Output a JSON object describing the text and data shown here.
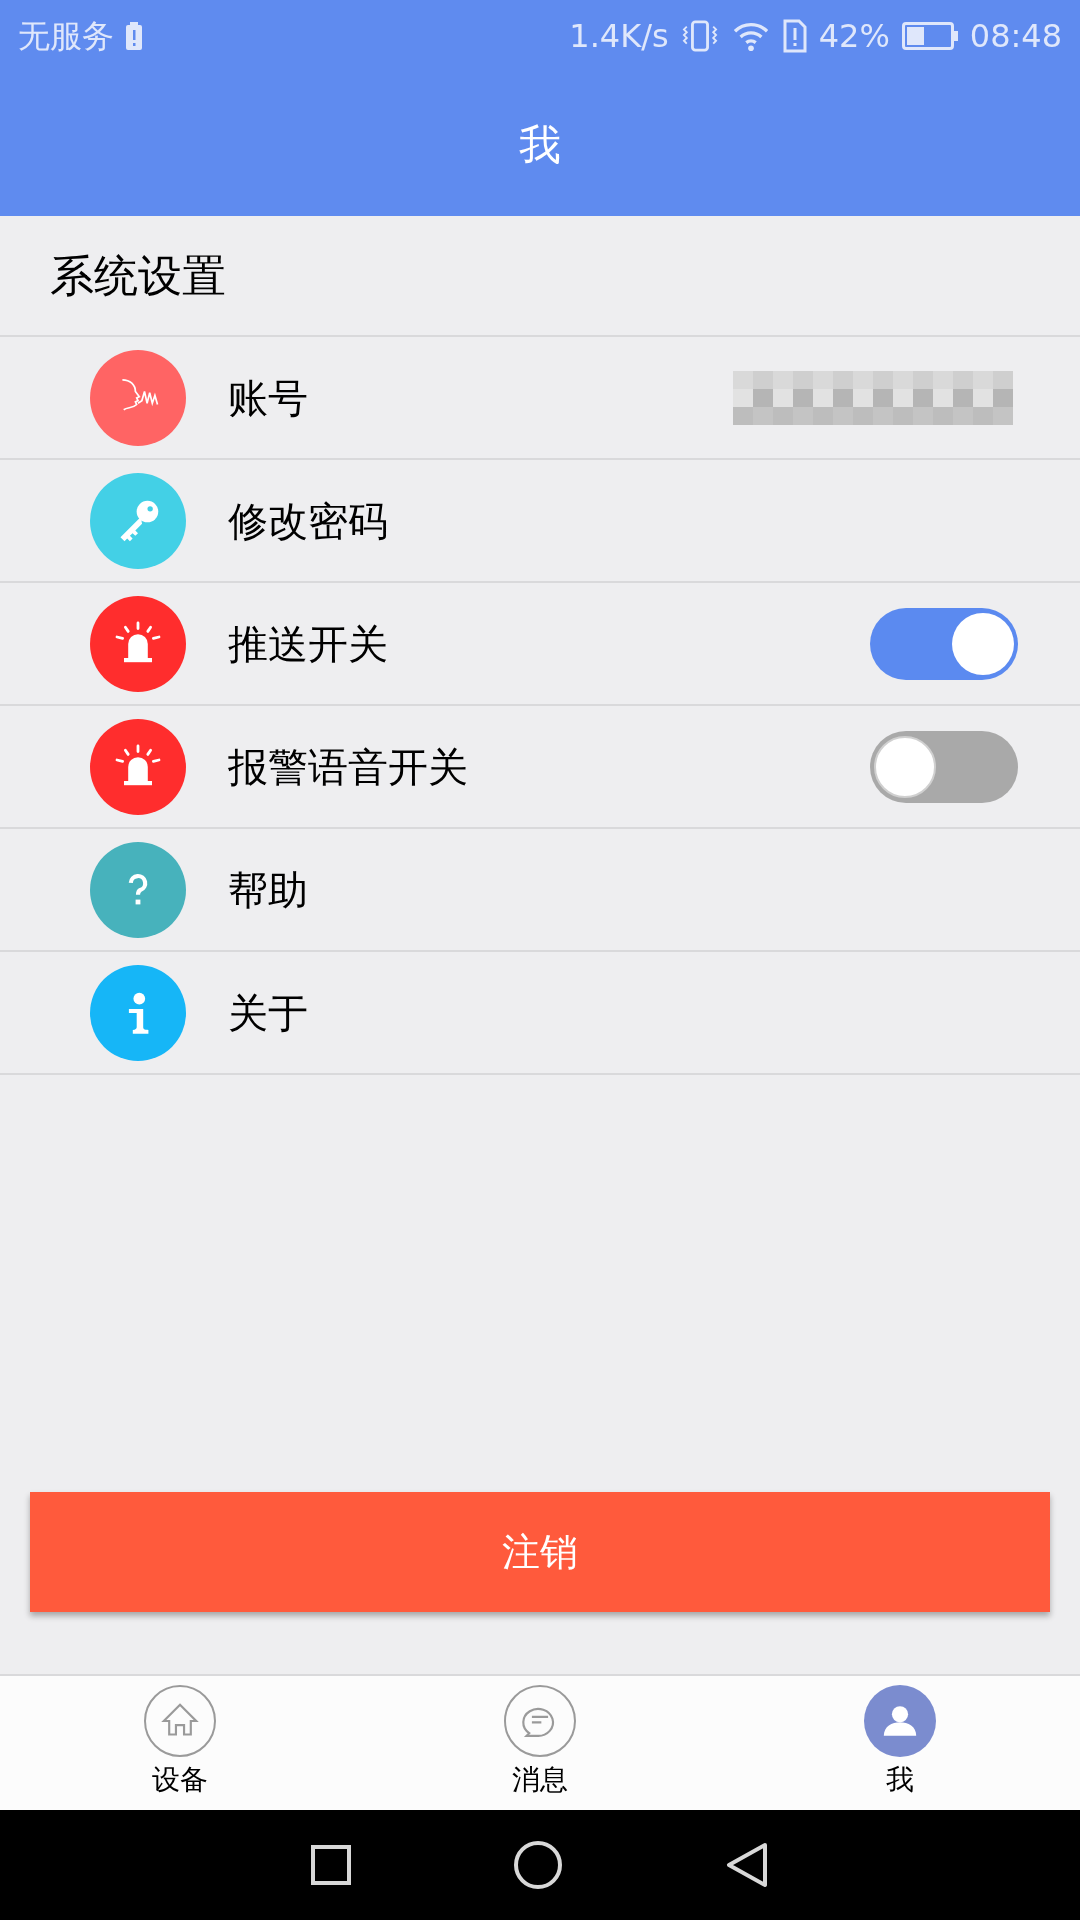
{
  "status_bar": {
    "carrier": "无服务",
    "speed": "1.4K/s",
    "battery": "42%",
    "time": "08:48"
  },
  "title": "我",
  "section": "系统设置",
  "rows": [
    {
      "kind": "speech",
      "color": "#ff6464",
      "label": "账号",
      "redacted": true
    },
    {
      "kind": "key",
      "color": "#43d0e6",
      "label": "修改密码"
    },
    {
      "kind": "alarm",
      "color": "#ff2d2d",
      "label": "推送开关",
      "on": true
    },
    {
      "kind": "alarm",
      "color": "#ff2d2d",
      "label": "报警语音开关",
      "on": false
    },
    {
      "kind": "help",
      "color": "#47b2bc",
      "label": "帮助"
    },
    {
      "kind": "info",
      "color": "#16b6f7",
      "label": "关于"
    }
  ],
  "logout_button": "注销",
  "bottom_nav": [
    {
      "kind": "home",
      "label": "设备",
      "selected": false
    },
    {
      "kind": "message",
      "label": "消息",
      "selected": false
    },
    {
      "kind": "person",
      "label": "我",
      "selected": true
    }
  ]
}
